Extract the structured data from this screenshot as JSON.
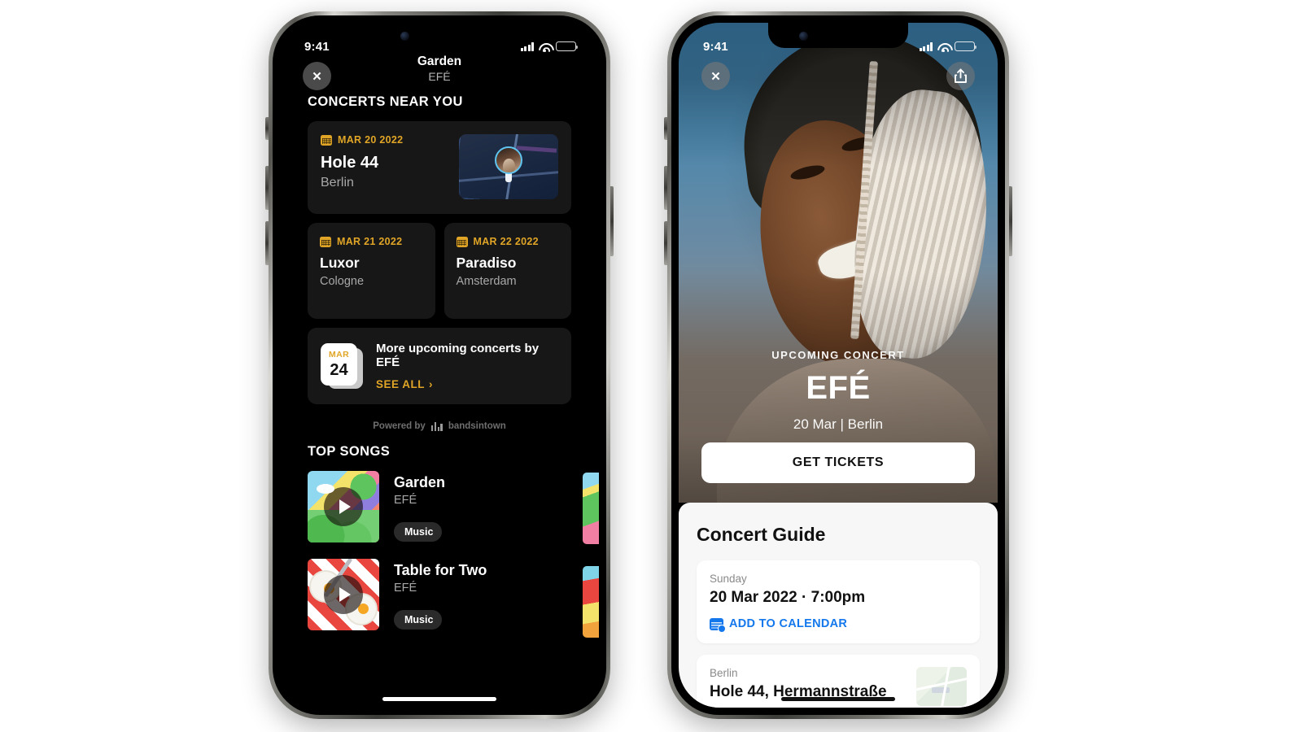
{
  "status_bar": {
    "time": "9:41",
    "signal_icon": "cellular-bars-icon",
    "wifi_icon": "wifi-icon",
    "battery_icon": "battery-icon"
  },
  "left_phone": {
    "nav": {
      "close_icon": "close-x-icon",
      "title": "Garden",
      "subtitle": "EFÉ"
    },
    "concerts_section": {
      "heading": "CONCERTS NEAR YOU",
      "featured": {
        "date": "MAR 20 2022",
        "venue": "Hole 44",
        "city": "Berlin",
        "map_icon": "map-thumbnail",
        "pin_icon": "map-avatar-pin-icon"
      },
      "others": [
        {
          "date": "MAR 21 2022",
          "venue": "Luxor",
          "city": "Cologne"
        },
        {
          "date": "MAR 22 2022",
          "venue": "Paradiso",
          "city": "Amsterdam"
        }
      ],
      "more": {
        "cal_month": "MAR",
        "cal_day": "24",
        "text": "More upcoming concerts by EFÉ",
        "see_all": "SEE ALL",
        "chevron": "›"
      },
      "powered_by": "Powered by",
      "powered_brand": "bandsintown"
    },
    "songs_section": {
      "heading": "TOP SONGS",
      "items": [
        {
          "title": "Garden",
          "artist": "EFÉ",
          "badge": "Music",
          "apple_glyph": "",
          "play_icon": "play-icon",
          "art_name": "album-art-garden"
        },
        {
          "title": "Table for Two",
          "artist": "EFÉ",
          "badge": "Music",
          "apple_glyph": "",
          "play_icon": "play-icon",
          "art_name": "album-art-table-for-two"
        }
      ]
    }
  },
  "right_phone": {
    "nav": {
      "close_icon": "close-x-icon",
      "share_icon": "share-icon"
    },
    "hero": {
      "kicker": "UPCOMING CONCERT",
      "name": "EFÉ",
      "subtitle": "20 Mar | Berlin",
      "cta": "GET TICKETS",
      "photo_name": "artist-portrait-photo"
    },
    "sheet": {
      "title": "Concert Guide",
      "date_card": {
        "label": "Sunday",
        "value": "20 Mar 2022 · 7:00pm",
        "action": "ADD TO CALENDAR",
        "action_icon": "calendar-add-icon"
      },
      "venue_card": {
        "label": "Berlin",
        "value": "Hole 44, Hermannstraße",
        "map_icon": "venue-map-thumbnail"
      }
    }
  },
  "colors": {
    "accent_orange": "#e0a526",
    "accent_blue": "#1478ec",
    "card_dark": "#171717",
    "sheet_bg": "#f7f7f7"
  }
}
